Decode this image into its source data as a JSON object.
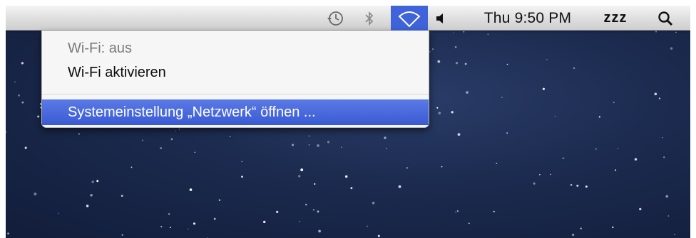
{
  "menubar": {
    "icons": {
      "time_machine": "time-machine-icon",
      "bluetooth": "bluetooth-icon",
      "wifi": "wifi-icon",
      "volume": "volume-icon",
      "spotlight": "search-icon"
    },
    "clock": "Thu 9:50 PM",
    "sleep": "zzz"
  },
  "wifi_menu": {
    "status": "Wi-Fi: aus",
    "enable": "Wi-Fi aktivieren",
    "open_prefs": "Systemeinstellung „Netzwerk“ öffnen ..."
  },
  "colors": {
    "highlight": "#3f63d8",
    "desktop": "#1b2a4e",
    "menubar": "#dcdcdc"
  }
}
